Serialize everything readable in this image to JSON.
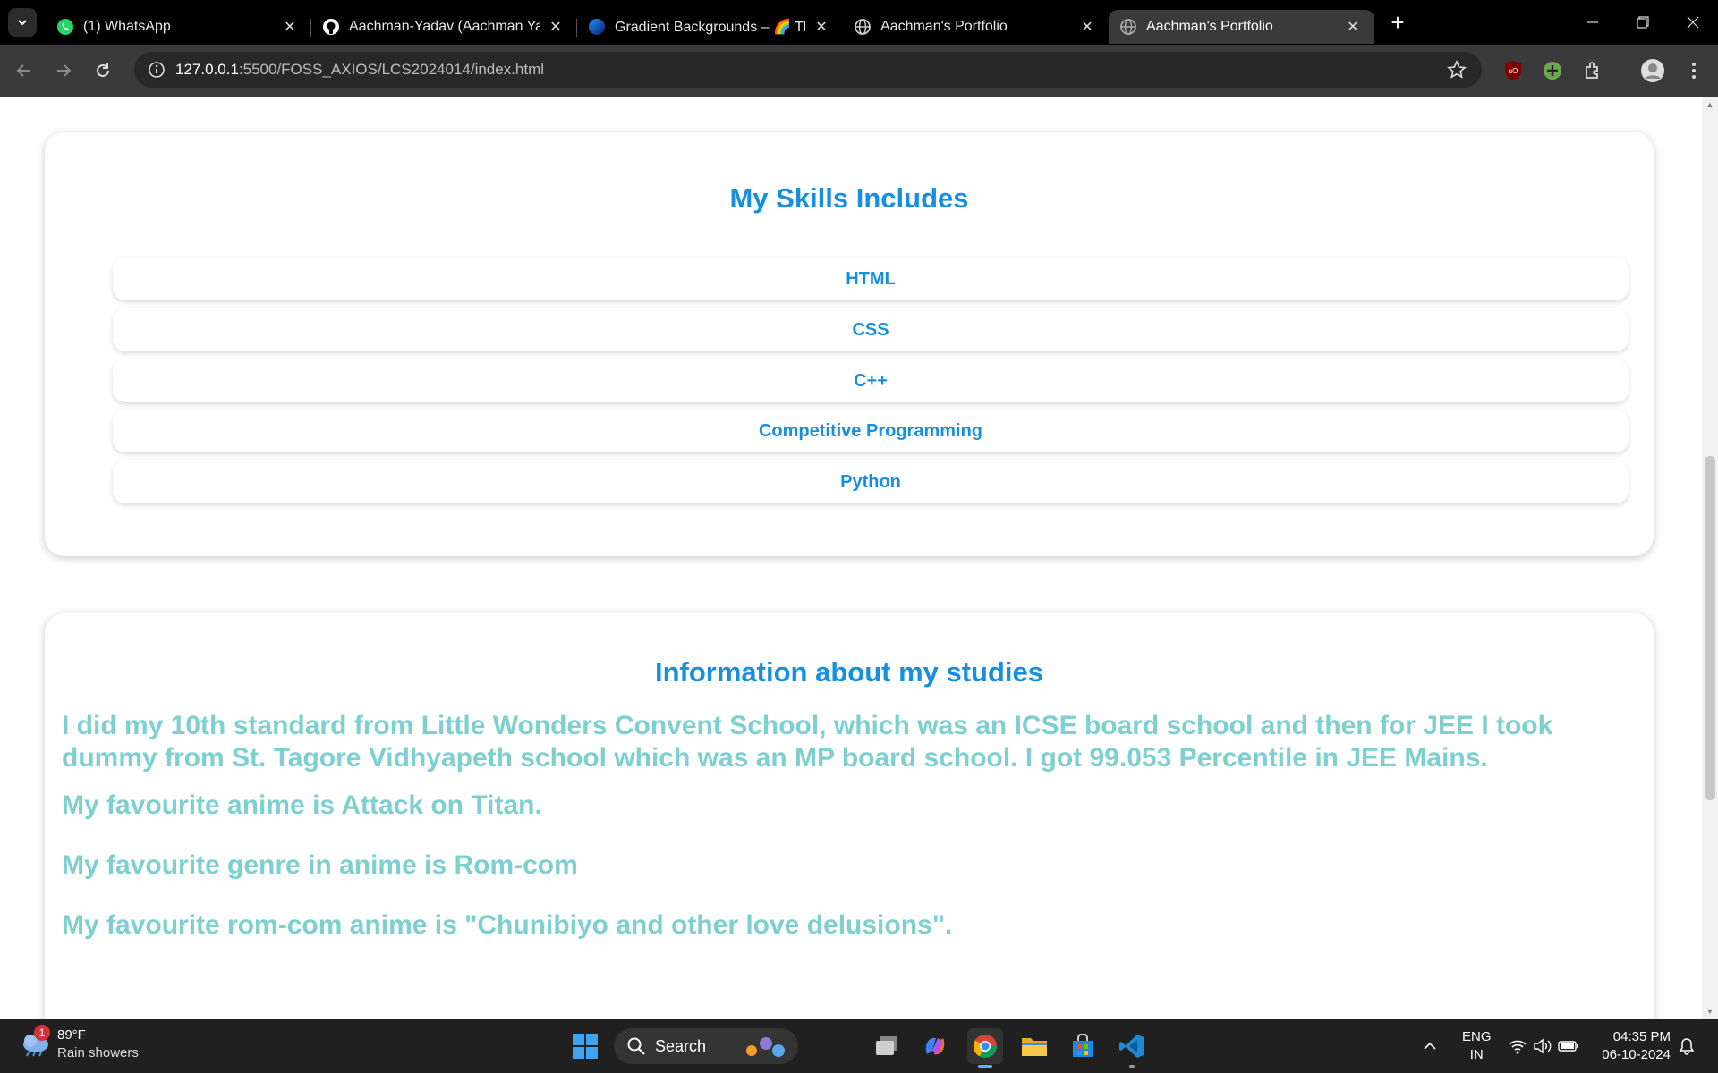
{
  "browser": {
    "tabs": [
      {
        "title": "(1) WhatsApp",
        "icon": "whatsapp-icon"
      },
      {
        "title": "Aachman-Yadav (Aachman Yada",
        "icon": "github-icon"
      },
      {
        "title": "Gradient Backgrounds – 🌈 The",
        "icon": "gradient-icon"
      },
      {
        "title": "Aachman's Portfolio",
        "icon": "globe-icon"
      },
      {
        "title": "Aachman's Portfolio",
        "icon": "globe-icon",
        "active": true
      }
    ],
    "url_host": "127.0.0.1",
    "url_path": ":5500/FOSS_AXIOS/LCS2024014/index.html"
  },
  "skills": {
    "heading": "My Skills Includes",
    "items": [
      "HTML",
      "CSS",
      "C++",
      "Competitive Programming",
      "Python"
    ]
  },
  "studies": {
    "heading": "Information about my studies",
    "paragraphs": [
      "I did my 10th standard from Little Wonders Convent School, which was an ICSE board school and then for JEE I took dummy from St. Tagore Vidhyapeth school which was an MP board school. I got 99.053 Percentile in JEE Mains.",
      "My favourite anime is Attack on Titan.",
      "My favourite genre in anime is Rom-com",
      "My favourite rom-com anime is \"Chunibiyo and other love delusions\"."
    ]
  },
  "colors": {
    "heading": "#168fe0",
    "paragraph": "#7dcfd0"
  },
  "taskbar": {
    "weather_badge": "1",
    "temperature": "89°F",
    "weather_desc": "Rain showers",
    "search_label": "Search",
    "lang_top": "ENG",
    "lang_bottom": "IN",
    "time": "04:35 PM",
    "date": "06-10-2024"
  }
}
